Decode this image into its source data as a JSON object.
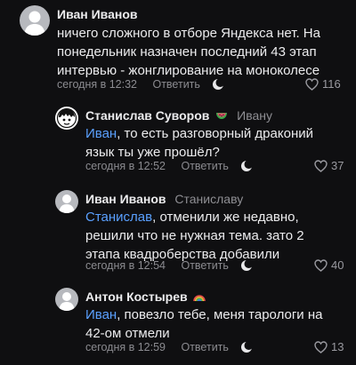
{
  "comments": [
    {
      "author": "Иван Иванов",
      "reply_to": "",
      "badge": "",
      "mention": "",
      "text": "ничего сложного в отборе Яндекса нет. На понедельник назначен последний 43 этап интервью - жонглирование на моноколесе",
      "time": "сегодня в 12:32",
      "reply_label": "Ответить",
      "likes": "116"
    },
    {
      "author": "Станислав Суворов",
      "reply_to": "Ивану",
      "badge": "watermelon-icon",
      "mention": "Иван",
      "text": ", то есть разговорный драконий язык ты уже прошёл?",
      "time": "сегодня в 12:52",
      "reply_label": "Ответить",
      "likes": "37"
    },
    {
      "author": "Иван Иванов",
      "reply_to": "Станиславу",
      "badge": "",
      "mention": "Станислав",
      "text": ", отменили же недавно, решили что не нужная тема. зато 2 этапа квадроберства добавили",
      "time": "сегодня в 12:54",
      "reply_label": "Ответить",
      "likes": "40"
    },
    {
      "author": "Антон Костырев",
      "reply_to": "",
      "badge": "rainbow-icon",
      "mention": "Иван",
      "text": ", повезло тебе, меня тарологи на 42-ом отмели",
      "time": "сегодня в 12:59",
      "reply_label": "Ответить",
      "likes": "13"
    }
  ],
  "colors": {
    "background": "#0f0f11",
    "mention": "#5aa0ff",
    "muted": "#8b8b90"
  }
}
